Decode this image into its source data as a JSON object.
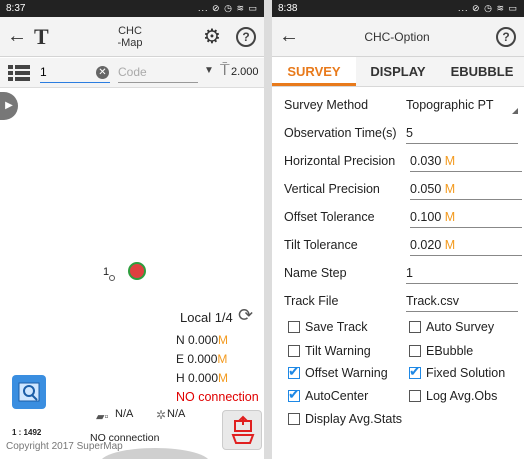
{
  "left": {
    "status_time": "8:37",
    "status_icons": "... ⊘ ◷ ≋ ▭",
    "title_line1": "CHC",
    "title_line2": "-Map",
    "point_name": "1",
    "code_placeholder": "Code",
    "height_value": "2.000",
    "local_label": "Local 1/4",
    "north": "N 0.000",
    "east": "E 0.000",
    "height": "H 0.000",
    "unit": "M",
    "connection_status": "NO connection",
    "signal_na_1": "N/A",
    "signal_na_2": "N/A",
    "scale": "1 : 1492",
    "bottom_status": "NO connection",
    "copyright": "Copyright 2017 SuperMap",
    "point_label": "1"
  },
  "right": {
    "status_time": "8:38",
    "status_icons": "... ⊘ ◷ ≋ ▭",
    "title": "CHC-Option",
    "tabs": [
      "SURVEY",
      "DISPLAY",
      "EBUBBLE"
    ],
    "fields": [
      {
        "label": "Survey Method",
        "value": "Topographic PT",
        "unit": ""
      },
      {
        "label": "Observation Time(s)",
        "value": "5",
        "unit": ""
      },
      {
        "label": "Horizontal Precision",
        "value": "0.030",
        "unit": "M"
      },
      {
        "label": "Vertical Precision",
        "value": "0.050",
        "unit": "M"
      },
      {
        "label": "Offset Tolerance",
        "value": "0.100",
        "unit": "M"
      },
      {
        "label": "Tilt Tolerance",
        "value": "0.020",
        "unit": "M"
      },
      {
        "label": "Name Step",
        "value": "1",
        "unit": ""
      },
      {
        "label": "Track File",
        "value": "Track.csv",
        "unit": ""
      }
    ],
    "checkboxes": [
      {
        "label": "Save Track",
        "checked": false
      },
      {
        "label": "Auto Survey",
        "checked": false
      },
      {
        "label": "Tilt Warning",
        "checked": false
      },
      {
        "label": "EBubble",
        "checked": false
      },
      {
        "label": "Offset Warning",
        "checked": true
      },
      {
        "label": "Fixed Solution",
        "checked": true
      },
      {
        "label": "AutoCenter",
        "checked": true
      },
      {
        "label": "Log Avg.Obs",
        "checked": false
      },
      {
        "label": "Display Avg.Stats",
        "checked": false
      }
    ]
  },
  "colors": {
    "accent": "#e87a1b",
    "unit": "#f39a1e",
    "check": "#1e88e5",
    "error": "#e00000"
  }
}
